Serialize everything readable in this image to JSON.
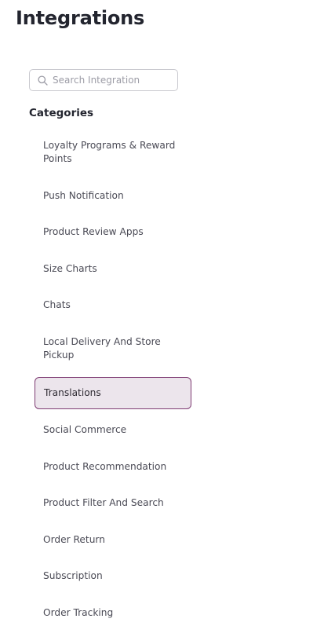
{
  "page_title": "Integrations",
  "search": {
    "placeholder": "Search Integration",
    "value": ""
  },
  "categories_heading": "Categories",
  "categories": [
    {
      "label": "Loyalty Programs & Reward Points"
    },
    {
      "label": "Push Notification"
    },
    {
      "label": "Product Review Apps"
    },
    {
      "label": "Size Charts"
    },
    {
      "label": "Chats"
    },
    {
      "label": "Local Delivery And Store Pickup"
    },
    {
      "label": "Translations",
      "selected": true
    },
    {
      "label": "Social Commerce"
    },
    {
      "label": "Product Recommendation"
    },
    {
      "label": "Product Filter And Search"
    },
    {
      "label": "Order Return"
    },
    {
      "label": "Subscription"
    },
    {
      "label": "Order Tracking"
    }
  ],
  "colors": {
    "selected_background": "#ece5ec",
    "selected_border": "#7e3b73"
  }
}
